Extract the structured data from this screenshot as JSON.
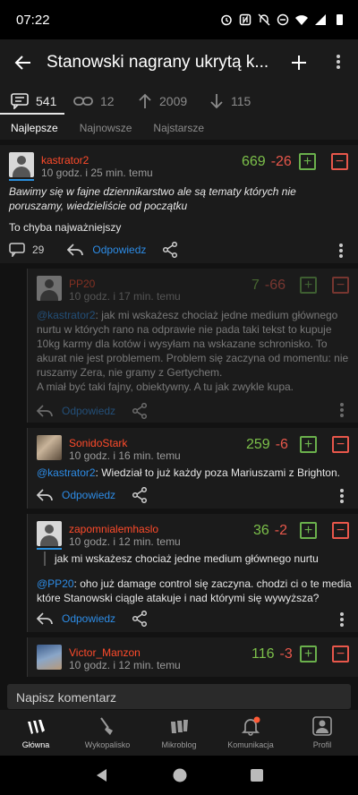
{
  "status": {
    "time": "07:22"
  },
  "header": {
    "title": "Stanowski nagrany ukrytą k..."
  },
  "stats": [
    {
      "icon": "comments-icon",
      "value": "541"
    },
    {
      "icon": "link-icon",
      "value": "12"
    },
    {
      "icon": "arrow-up-icon",
      "value": "2009"
    },
    {
      "icon": "arrow-down-icon",
      "value": "115"
    }
  ],
  "sort": {
    "best": "Najlepsze",
    "newest": "Najnowsze",
    "oldest": "Najstarsze"
  },
  "comments": [
    {
      "author": "kastrator2",
      "time": "10 godz. i 25 min. temu",
      "plus": "669",
      "minus": "-26",
      "text1": "Bawimy się w fajne dziennikarstwo ale są tematy których nie poruszamy, wiedzieliście od początku",
      "text2": "To chyba najważniejszy",
      "replies_count": "29",
      "reply_label": "Odpowiedz"
    },
    {
      "author": "PP20",
      "time": "10 godz. i 17 min. temu",
      "plus": "7",
      "minus": "-66",
      "mention": "@kastrator2",
      "text1": ": jak mi wskażesz chociaż jedne medium głównego nurtu w których rano na odprawie nie pada taki tekst to kupuje 10kg karmy dla kotów i wysyłam na wskazane schronisko. To akurat nie jest problemem. Problem się zaczyna od momentu: nie ruszamy Zera, nie gramy z Gertychem.",
      "text2": "A miał być taki fajny, obiektywny. A tu jak zwykle kupa.",
      "reply_label": "Odpowiedz"
    },
    {
      "author": "SonidoStark",
      "time": "10 godz. i 16 min. temu",
      "plus": "259",
      "minus": "-6",
      "mention": "@kastrator2",
      "text1": ": Wiedział to już każdy poza Mariuszami z Brighton.",
      "reply_label": "Odpowiedz"
    },
    {
      "author": "zapomnialemhaslo",
      "time": "10 godz. i 12 min. temu",
      "plus": "36",
      "minus": "-2",
      "quote": "jak mi wskażesz chociaż jedne medium głównego nurtu",
      "mention": "@PP20",
      "text1": ": oho już damage control się zaczyna. chodzi ci o te media które Stanowski ciągle atakuje i nad którymi się wywyższa?",
      "reply_label": "Odpowiedz"
    },
    {
      "author": "Victor_Manzon",
      "time": "10 godz. i 12 min. temu",
      "plus": "116",
      "minus": "-3"
    }
  ],
  "composer": {
    "placeholder": "Napisz komentarz"
  },
  "nav": [
    {
      "label": "Główna",
      "icon": "home-icon"
    },
    {
      "label": "Wykopalisko",
      "icon": "shovel-icon"
    },
    {
      "label": "Mikroblog",
      "icon": "microblog-icon"
    },
    {
      "label": "Komunikacja",
      "icon": "bell-icon"
    },
    {
      "label": "Profil",
      "icon": "profile-icon"
    }
  ],
  "colors": {
    "plus": "#7cc04a",
    "minus": "#e8574b",
    "author": "#ff4b2b",
    "link": "#2d8ce6"
  }
}
